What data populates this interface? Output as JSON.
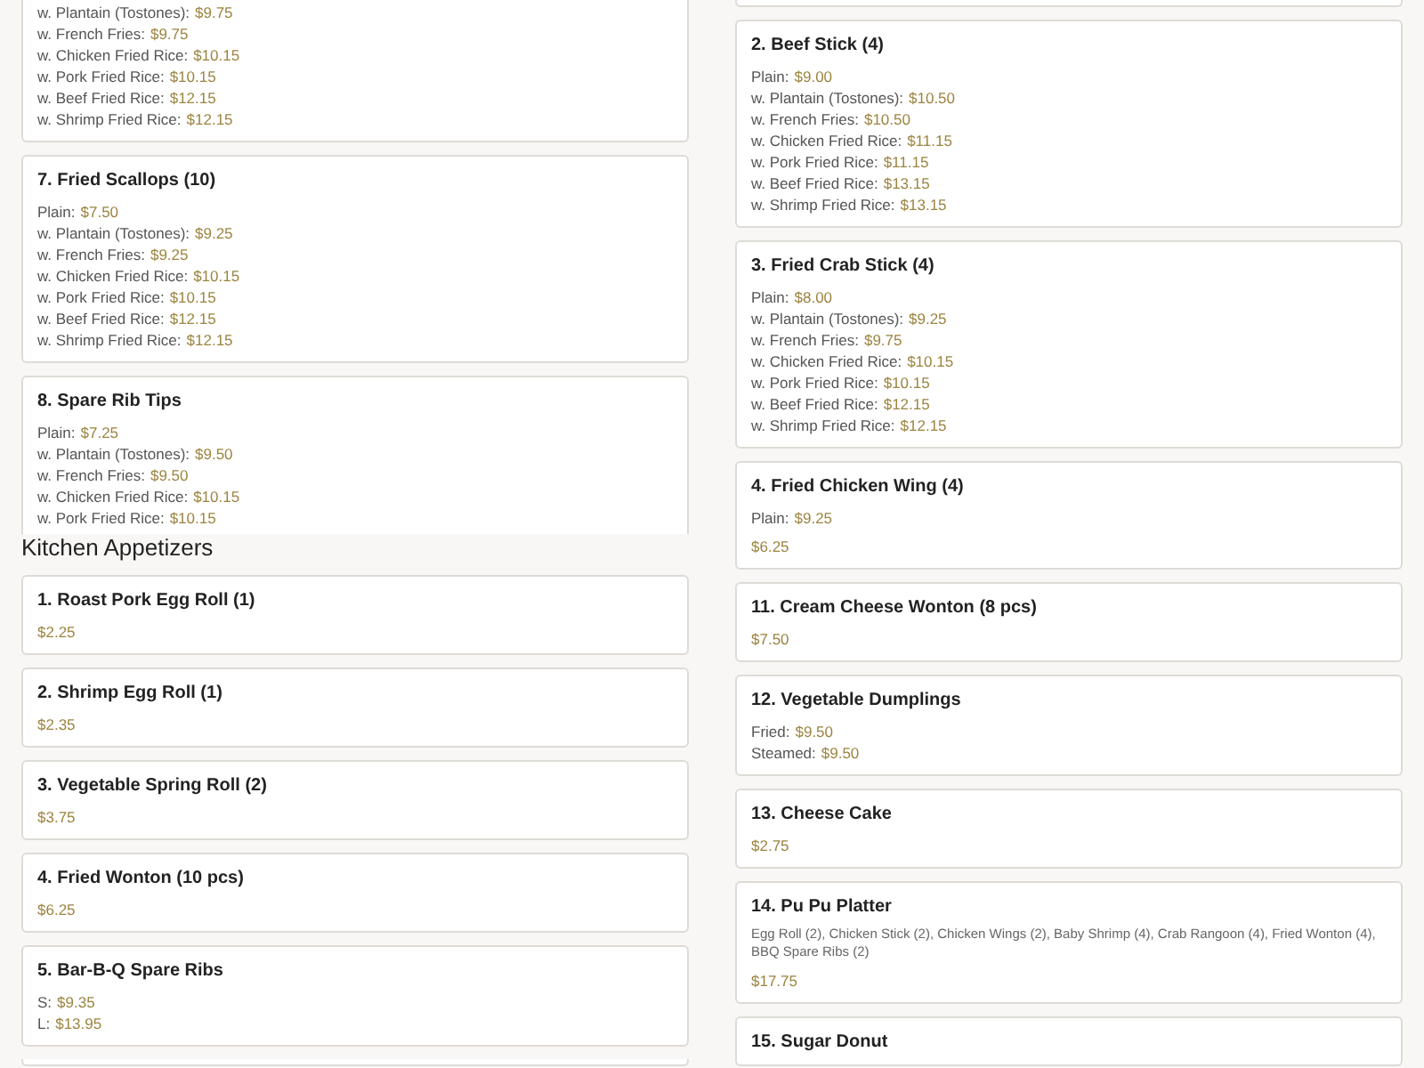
{
  "views": [
    {
      "columns": [
        {
          "cards": [
            {
              "kind": "partial",
              "prices": [
                {
                  "label": "w. Plantain (Tostones):",
                  "price": "$9.75"
                },
                {
                  "label": "w. French Fries:",
                  "price": "$9.75"
                },
                {
                  "label": "w. Chicken Fried Rice:",
                  "price": "$10.15"
                },
                {
                  "label": "w. Pork Fried Rice:",
                  "price": "$10.15"
                },
                {
                  "label": "w. Beef Fried Rice:",
                  "price": "$12.15"
                },
                {
                  "label": "w. Shrimp Fried Rice:",
                  "price": "$12.15"
                }
              ]
            },
            {
              "kind": "item",
              "title": "7. Fried Scallops (10)",
              "prices": [
                {
                  "label": "Plain:",
                  "price": "$7.50"
                },
                {
                  "label": "w. Plantain (Tostones):",
                  "price": "$9.25"
                },
                {
                  "label": "w. French Fries:",
                  "price": "$9.25"
                },
                {
                  "label": "w. Chicken Fried Rice:",
                  "price": "$10.15"
                },
                {
                  "label": "w. Pork Fried Rice:",
                  "price": "$10.15"
                },
                {
                  "label": "w. Beef Fried Rice:",
                  "price": "$12.15"
                },
                {
                  "label": "w. Shrimp Fried Rice:",
                  "price": "$12.15"
                }
              ]
            },
            {
              "kind": "item",
              "title": "8. Spare Rib Tips",
              "prices": [
                {
                  "label": "Plain:",
                  "price": "$7.25"
                },
                {
                  "label": "w. Plantain (Tostones):",
                  "price": "$9.50"
                },
                {
                  "label": "w. French Fries:",
                  "price": "$9.50"
                },
                {
                  "label": "w. Chicken Fried Rice:",
                  "price": "$10.15"
                },
                {
                  "label": "w. Pork Fried Rice:",
                  "price": "$10.15"
                }
              ]
            }
          ]
        },
        {
          "cards": [
            {
              "kind": "edge"
            },
            {
              "kind": "item",
              "title": "2. Beef Stick (4)",
              "prices": [
                {
                  "label": "Plain:",
                  "price": "$9.00"
                },
                {
                  "label": "w. Plantain (Tostones):",
                  "price": "$10.50"
                },
                {
                  "label": "w. French Fries:",
                  "price": "$10.50"
                },
                {
                  "label": "w. Chicken Fried Rice:",
                  "price": "$11.15"
                },
                {
                  "label": "w. Pork Fried Rice:",
                  "price": "$11.15"
                },
                {
                  "label": "w. Beef Fried Rice:",
                  "price": "$13.15"
                },
                {
                  "label": "w. Shrimp Fried Rice:",
                  "price": "$13.15"
                }
              ]
            },
            {
              "kind": "item",
              "title": "3. Fried Crab Stick (4)",
              "prices": [
                {
                  "label": "Plain:",
                  "price": "$8.00"
                },
                {
                  "label": "w. Plantain (Tostones):",
                  "price": "$9.25"
                },
                {
                  "label": "w. French Fries:",
                  "price": "$9.75"
                },
                {
                  "label": "w. Chicken Fried Rice:",
                  "price": "$10.15"
                },
                {
                  "label": "w. Pork Fried Rice:",
                  "price": "$10.15"
                },
                {
                  "label": "w. Beef Fried Rice:",
                  "price": "$12.15"
                },
                {
                  "label": "w. Shrimp Fried Rice:",
                  "price": "$12.15"
                }
              ]
            },
            {
              "kind": "item",
              "title": "4. Fried Chicken Wing (4)",
              "prices": [
                {
                  "label": "Plain:",
                  "price": "$9.25"
                }
              ]
            }
          ]
        }
      ]
    },
    {
      "columns": [
        {
          "heading": "Kitchen Appetizers",
          "cards": [
            {
              "kind": "item",
              "title": "1. Roast Pork Egg Roll (1)",
              "prices": [
                {
                  "price": "$2.25"
                }
              ]
            },
            {
              "kind": "item",
              "title": "2. Shrimp Egg Roll (1)",
              "prices": [
                {
                  "price": "$2.35"
                }
              ]
            },
            {
              "kind": "item",
              "title": "3. Vegetable Spring Roll (2)",
              "prices": [
                {
                  "price": "$3.75"
                }
              ]
            },
            {
              "kind": "item",
              "title": "4. Fried Wonton (10 pcs)",
              "prices": [
                {
                  "price": "$6.25"
                }
              ]
            },
            {
              "kind": "item",
              "title": "5. Bar-B-Q Spare Ribs",
              "prices": [
                {
                  "label": "S:",
                  "price": "$9.35"
                },
                {
                  "label": "L:",
                  "price": "$13.95"
                }
              ]
            },
            {
              "kind": "edge"
            }
          ]
        },
        {
          "cards": [
            {
              "kind": "partial",
              "prices": [
                {
                  "price": "$6.25"
                }
              ]
            },
            {
              "kind": "item",
              "title": "11. Cream Cheese Wonton (8 pcs)",
              "prices": [
                {
                  "price": "$7.50"
                }
              ]
            },
            {
              "kind": "item",
              "title": "12. Vegetable Dumplings",
              "prices": [
                {
                  "label": "Fried:",
                  "price": "$9.50"
                },
                {
                  "label": "Steamed:",
                  "price": "$9.50"
                }
              ]
            },
            {
              "kind": "item",
              "title": "13. Cheese Cake",
              "prices": [
                {
                  "price": "$2.75"
                }
              ]
            },
            {
              "kind": "item",
              "title": "14. Pu Pu Platter",
              "description": "Egg Roll (2), Chicken Stick (2), Chicken Wings (2), Baby Shrimp (4), Crab Rangoon (4), Fried Wonton (4), BBQ Spare Ribs (2)",
              "prices": [
                {
                  "price": "$17.75"
                }
              ]
            },
            {
              "kind": "item",
              "title": "15. Sugar Donut"
            }
          ]
        }
      ]
    }
  ]
}
